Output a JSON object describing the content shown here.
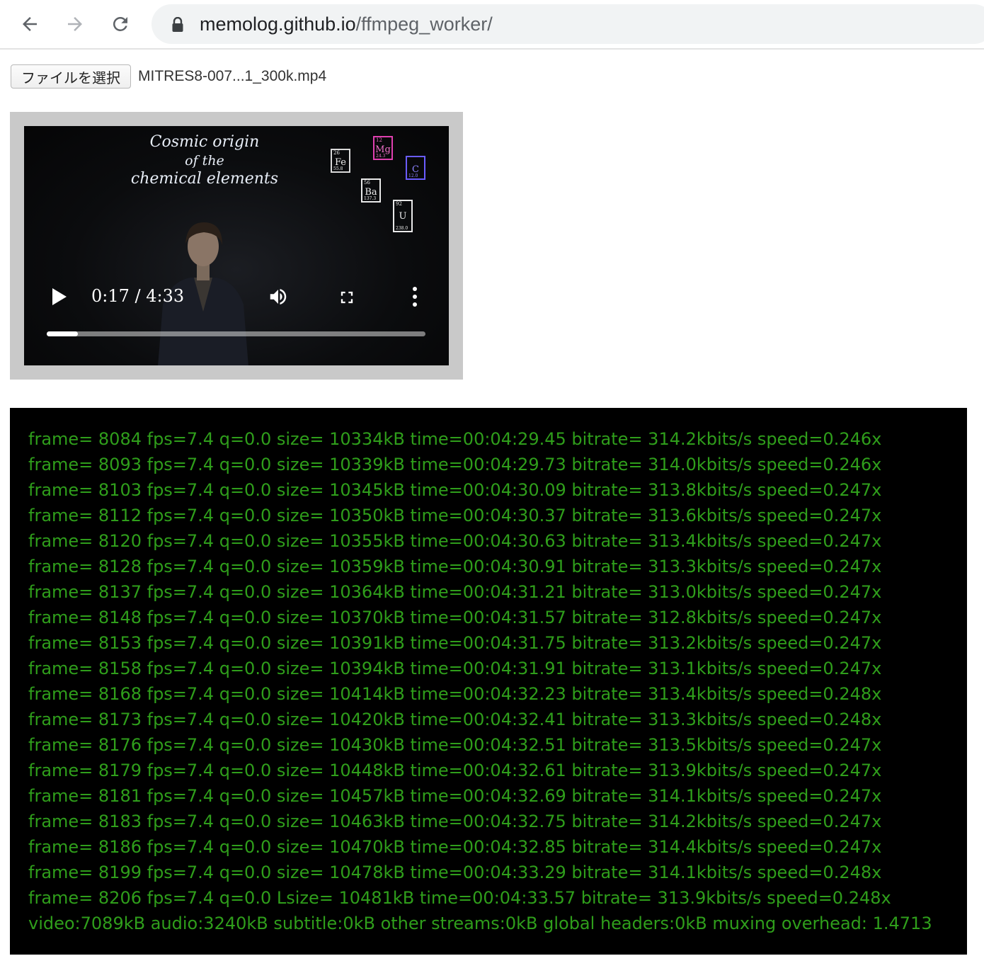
{
  "browser": {
    "url_host": "memolog.github.io",
    "url_path": "/ffmpeg_worker/"
  },
  "file_input": {
    "button_label": "ファイルを選択",
    "file_name": "MITRES8-007...1_300k.mp4"
  },
  "video": {
    "board_title": [
      "Cosmic origin",
      "of the",
      "chemical elements"
    ],
    "tiles": [
      {
        "num": "26",
        "sym": "Fe",
        "mass": "55.8"
      },
      {
        "num": "12",
        "sym": "Mg",
        "mass": "24.3"
      },
      {
        "num": "",
        "sym": "C",
        "mass": "12.0"
      },
      {
        "num": "56",
        "sym": "Ba",
        "mass": "137.3"
      },
      {
        "num": "92",
        "sym": "U",
        "mass": "238.0"
      }
    ],
    "time_display": "0:17 / 4:33",
    "progress_fraction": 0.082,
    "icons": [
      "play-icon",
      "volume-icon",
      "fullscreen-icon",
      "more-vert-icon"
    ]
  },
  "log": {
    "color": "#2f9e1b",
    "lines": [
      "frame= 8084 fps=7.4 q=0.0 size= 10334kB time=00:04:29.45 bitrate= 314.2kbits/s speed=0.246x",
      "frame= 8093 fps=7.4 q=0.0 size= 10339kB time=00:04:29.73 bitrate= 314.0kbits/s speed=0.246x",
      "frame= 8103 fps=7.4 q=0.0 size= 10345kB time=00:04:30.09 bitrate= 313.8kbits/s speed=0.247x",
      "frame= 8112 fps=7.4 q=0.0 size= 10350kB time=00:04:30.37 bitrate= 313.6kbits/s speed=0.247x",
      "frame= 8120 fps=7.4 q=0.0 size= 10355kB time=00:04:30.63 bitrate= 313.4kbits/s speed=0.247x",
      "frame= 8128 fps=7.4 q=0.0 size= 10359kB time=00:04:30.91 bitrate= 313.3kbits/s speed=0.247x",
      "frame= 8137 fps=7.4 q=0.0 size= 10364kB time=00:04:31.21 bitrate= 313.0kbits/s speed=0.247x",
      "frame= 8148 fps=7.4 q=0.0 size= 10370kB time=00:04:31.57 bitrate= 312.8kbits/s speed=0.247x",
      "frame= 8153 fps=7.4 q=0.0 size= 10391kB time=00:04:31.75 bitrate= 313.2kbits/s speed=0.247x",
      "frame= 8158 fps=7.4 q=0.0 size= 10394kB time=00:04:31.91 bitrate= 313.1kbits/s speed=0.247x",
      "frame= 8168 fps=7.4 q=0.0 size= 10414kB time=00:04:32.23 bitrate= 313.4kbits/s speed=0.248x",
      "frame= 8173 fps=7.4 q=0.0 size= 10420kB time=00:04:32.41 bitrate= 313.3kbits/s speed=0.248x",
      "frame= 8176 fps=7.4 q=0.0 size= 10430kB time=00:04:32.51 bitrate= 313.5kbits/s speed=0.247x",
      "frame= 8179 fps=7.4 q=0.0 size= 10448kB time=00:04:32.61 bitrate= 313.9kbits/s speed=0.247x",
      "frame= 8181 fps=7.4 q=0.0 size= 10457kB time=00:04:32.69 bitrate= 314.1kbits/s speed=0.247x",
      "frame= 8183 fps=7.4 q=0.0 size= 10463kB time=00:04:32.75 bitrate= 314.2kbits/s speed=0.247x",
      "frame= 8186 fps=7.4 q=0.0 size= 10470kB time=00:04:32.85 bitrate= 314.4kbits/s speed=0.247x",
      "frame= 8199 fps=7.4 q=0.0 size= 10478kB time=00:04:33.29 bitrate= 314.1kbits/s speed=0.248x",
      "frame= 8206 fps=7.4 q=0.0 Lsize= 10481kB time=00:04:33.57 bitrate= 313.9kbits/s speed=0.248x",
      "video:7089kB audio:3240kB subtitle:0kB other streams:0kB global headers:0kB muxing overhead: 1.4713"
    ]
  }
}
